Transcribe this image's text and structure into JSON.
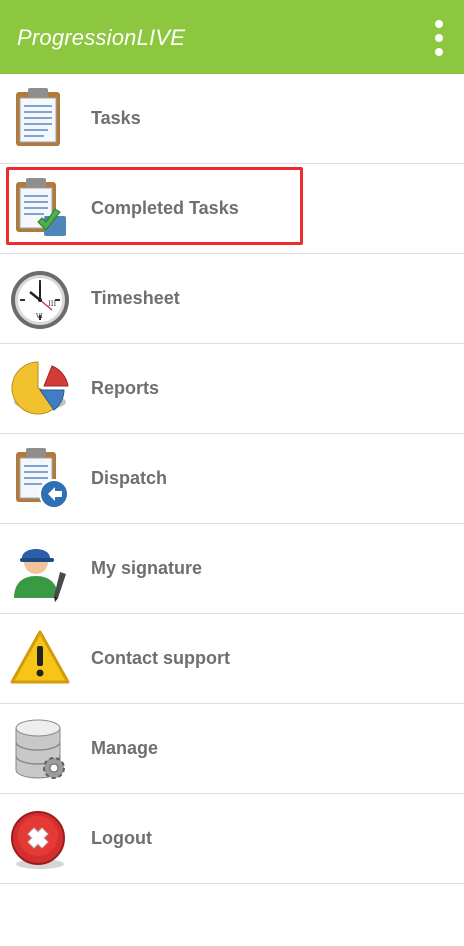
{
  "app": {
    "title": "ProgressionLIVE",
    "brand_color": "#8dc63f",
    "overflow_icon": "more-vert-icon"
  },
  "menu": {
    "items": [
      {
        "label": "Tasks",
        "icon": "clipboard-icon"
      },
      {
        "label": "Completed Tasks",
        "icon": "clipboard-check-icon"
      },
      {
        "label": "Timesheet",
        "icon": "clock-icon"
      },
      {
        "label": "Reports",
        "icon": "pie-chart-icon"
      },
      {
        "label": "Dispatch",
        "icon": "clipboard-dispatch-icon"
      },
      {
        "label": "My signature",
        "icon": "user-signature-icon"
      },
      {
        "label": "Contact support",
        "icon": "warning-icon"
      },
      {
        "label": "Manage",
        "icon": "database-gear-icon"
      },
      {
        "label": "Logout",
        "icon": "logout-x-icon"
      }
    ],
    "highlighted_item": "Completed Tasks",
    "highlight_color": "#ee2a2a"
  }
}
